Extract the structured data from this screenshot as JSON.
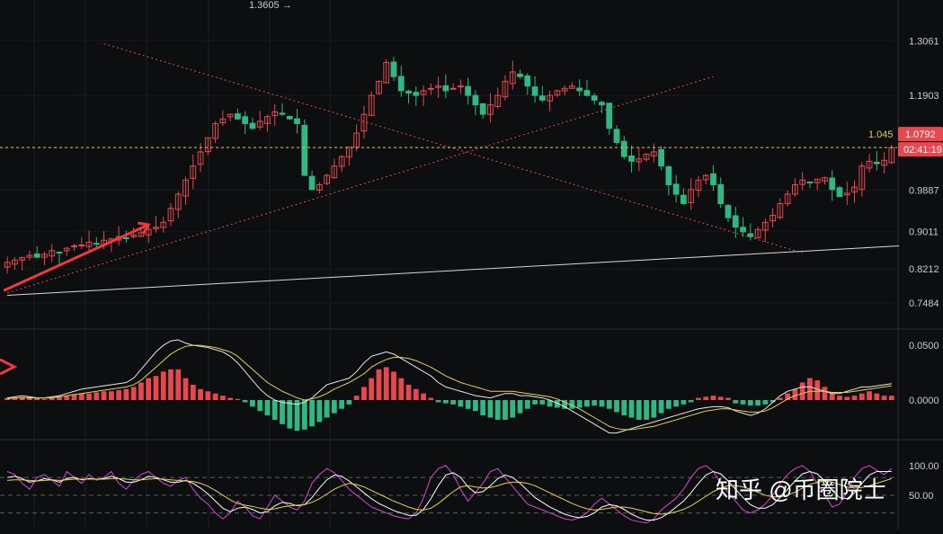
{
  "chart_data": [
    {
      "type": "candlestick",
      "panel": "price",
      "ylim": [
        0.72,
        1.37
      ],
      "y_ticks": [
        "1.3061",
        "1.1903",
        "1.0792",
        "0.9887",
        "0.9011",
        "0.8212",
        "0.7484"
      ],
      "y_tick_values": [
        1.3061,
        1.1903,
        1.0792,
        0.9887,
        0.9011,
        0.8212,
        0.7484
      ],
      "high_annotation": "1.3605 →",
      "high_value": 1.3605,
      "current_price": "1.0792",
      "current_price_value": 1.0792,
      "countdown": "02:41:19",
      "overlay_text": "1.045",
      "n_candles": 120,
      "approx_closes": [
        0.835,
        0.84,
        0.845,
        0.85,
        0.846,
        0.852,
        0.86,
        0.855,
        0.865,
        0.87,
        0.872,
        0.878,
        0.875,
        0.882,
        0.885,
        0.89,
        0.887,
        0.893,
        0.898,
        0.905,
        0.91,
        0.92,
        0.95,
        0.98,
        1.01,
        1.04,
        1.07,
        1.1,
        1.13,
        1.14,
        1.15,
        1.14,
        1.13,
        1.12,
        1.135,
        1.145,
        1.155,
        1.15,
        1.14,
        1.13,
        1.02,
        0.99,
        1.0,
        1.02,
        1.04,
        1.06,
        1.08,
        1.11,
        1.15,
        1.19,
        1.22,
        1.26,
        1.23,
        1.2,
        1.195,
        1.19,
        1.2,
        1.205,
        1.21,
        1.2,
        1.205,
        1.21,
        1.19,
        1.17,
        1.15,
        1.17,
        1.19,
        1.22,
        1.24,
        1.23,
        1.21,
        1.19,
        1.18,
        1.19,
        1.2,
        1.205,
        1.21,
        1.2,
        1.19,
        1.18,
        1.17,
        1.12,
        1.09,
        1.06,
        1.05,
        1.055,
        1.065,
        1.07,
        1.04,
        1.0,
        0.98,
        0.96,
        0.99,
        1.01,
        1.02,
        1.0,
        0.96,
        0.93,
        0.91,
        0.9,
        0.89,
        0.905,
        0.92,
        0.935,
        0.96,
        0.98,
        1.0,
        1.01,
        1.005,
        1.012,
        1.015,
        0.99,
        0.975,
        0.982,
        0.995,
        1.04,
        1.05,
        1.045,
        1.052,
        1.079
      ],
      "trendlines": [
        {
          "name": "descending-dotted",
          "points": [
            [
              13,
              1.3
            ],
            [
              107,
              0.855
            ]
          ]
        },
        {
          "name": "ascending-dotted",
          "points": [
            [
              0,
              0.77
            ],
            [
              95,
              1.23
            ]
          ]
        },
        {
          "name": "ascending-white",
          "points": [
            [
              0,
              0.765
            ],
            [
              120,
              0.87
            ]
          ]
        },
        {
          "name": "current-price-dashed",
          "points": [
            [
              0,
              1.0792
            ],
            [
              120,
              1.0792
            ]
          ]
        }
      ]
    },
    {
      "type": "histogram-line",
      "panel": "macd",
      "ylim": [
        -0.032,
        0.055
      ],
      "y_ticks": [
        "0.0500",
        "0.0000"
      ],
      "y_tick_values": [
        0.05,
        0.0
      ],
      "histogram": [
        0.002,
        0.002,
        0.003,
        0.003,
        0.002,
        0.001,
        0.002,
        0.003,
        0.004,
        0.005,
        0.006,
        0.006,
        0.007,
        0.008,
        0.008,
        0.009,
        0.01,
        0.012,
        0.016,
        0.02,
        0.022,
        0.026,
        0.028,
        0.028,
        0.02,
        0.014,
        0.01,
        0.008,
        0.006,
        0.004,
        0.002,
        0.001,
        -0.002,
        -0.006,
        -0.01,
        -0.014,
        -0.018,
        -0.022,
        -0.026,
        -0.028,
        -0.027,
        -0.024,
        -0.02,
        -0.016,
        -0.012,
        -0.008,
        -0.004,
        0.004,
        0.012,
        0.02,
        0.028,
        0.03,
        0.026,
        0.02,
        0.014,
        0.01,
        0.006,
        0.002,
        -0.002,
        -0.003,
        -0.004,
        -0.006,
        -0.008,
        -0.01,
        -0.014,
        -0.016,
        -0.018,
        -0.018,
        -0.016,
        -0.012,
        -0.008,
        -0.004,
        -0.004,
        -0.006,
        -0.007,
        -0.008,
        -0.008,
        -0.007,
        -0.006,
        -0.005,
        -0.006,
        -0.008,
        -0.011,
        -0.014,
        -0.016,
        -0.018,
        -0.018,
        -0.016,
        -0.012,
        -0.008,
        -0.006,
        -0.004,
        -0.002,
        0.002,
        0.003,
        0.004,
        0.003,
        0.002,
        -0.003,
        -0.004,
        -0.005,
        -0.005,
        -0.004,
        -0.002,
        0.002,
        0.006,
        0.01,
        0.016,
        0.02,
        0.018,
        0.012,
        0.006,
        0.004,
        0.003,
        0.004,
        0.006,
        0.008,
        0.006,
        0.004,
        0.004
      ],
      "line_macd": [
        0.002,
        0.003,
        0.004,
        0.003,
        0.002,
        0.002,
        0.003,
        0.004,
        0.006,
        0.008,
        0.01,
        0.011,
        0.012,
        0.013,
        0.014,
        0.015,
        0.016,
        0.02,
        0.028,
        0.036,
        0.044,
        0.05,
        0.054,
        0.055,
        0.052,
        0.05,
        0.049,
        0.048,
        0.046,
        0.044,
        0.04,
        0.034,
        0.026,
        0.018,
        0.01,
        0.004,
        0.0,
        -0.002,
        -0.003,
        -0.004,
        -0.002,
        0.002,
        0.008,
        0.014,
        0.016,
        0.018,
        0.02,
        0.026,
        0.034,
        0.04,
        0.042,
        0.044,
        0.042,
        0.038,
        0.034,
        0.03,
        0.026,
        0.022,
        0.016,
        0.012,
        0.01,
        0.008,
        0.006,
        0.004,
        0.003,
        0.002,
        0.004,
        0.006,
        0.006,
        0.004,
        0.004,
        0.003,
        0.002,
        0.0,
        -0.003,
        -0.006,
        -0.01,
        -0.014,
        -0.018,
        -0.022,
        -0.026,
        -0.03,
        -0.03,
        -0.028,
        -0.026,
        -0.024,
        -0.022,
        -0.02,
        -0.018,
        -0.016,
        -0.014,
        -0.012,
        -0.01,
        -0.008,
        -0.007,
        -0.006,
        -0.006,
        -0.007,
        -0.01,
        -0.012,
        -0.014,
        -0.012,
        -0.008,
        -0.002,
        0.004,
        0.008,
        0.01,
        0.012,
        0.012,
        0.01,
        0.008,
        0.006,
        0.006,
        0.008,
        0.01,
        0.012,
        0.012,
        0.013,
        0.014,
        0.015
      ],
      "line_signal": [
        0.001,
        0.002,
        0.002,
        0.002,
        0.002,
        0.002,
        0.002,
        0.003,
        0.004,
        0.005,
        0.006,
        0.007,
        0.008,
        0.009,
        0.01,
        0.011,
        0.012,
        0.014,
        0.018,
        0.024,
        0.03,
        0.036,
        0.042,
        0.046,
        0.049,
        0.05,
        0.05,
        0.049,
        0.048,
        0.046,
        0.044,
        0.04,
        0.034,
        0.028,
        0.022,
        0.016,
        0.012,
        0.008,
        0.005,
        0.002,
        0.0,
        0.001,
        0.003,
        0.006,
        0.01,
        0.013,
        0.016,
        0.02,
        0.024,
        0.03,
        0.034,
        0.037,
        0.039,
        0.039,
        0.038,
        0.036,
        0.033,
        0.03,
        0.026,
        0.022,
        0.019,
        0.016,
        0.014,
        0.012,
        0.01,
        0.008,
        0.008,
        0.008,
        0.008,
        0.007,
        0.006,
        0.005,
        0.004,
        0.003,
        0.001,
        -0.002,
        -0.005,
        -0.008,
        -0.012,
        -0.016,
        -0.02,
        -0.024,
        -0.026,
        -0.027,
        -0.027,
        -0.026,
        -0.025,
        -0.024,
        -0.022,
        -0.02,
        -0.018,
        -0.016,
        -0.014,
        -0.012,
        -0.01,
        -0.009,
        -0.008,
        -0.008,
        -0.009,
        -0.01,
        -0.011,
        -0.011,
        -0.01,
        -0.007,
        -0.003,
        0.001,
        0.004,
        0.006,
        0.008,
        0.008,
        0.008,
        0.007,
        0.007,
        0.007,
        0.008,
        0.009,
        0.01,
        0.011,
        0.012,
        0.013
      ]
    },
    {
      "type": "line",
      "panel": "stochastic",
      "ylim": [
        -8,
        112
      ],
      "y_ticks": [
        "100.00",
        "50.00"
      ],
      "y_tick_values": [
        100,
        50
      ],
      "dashed_levels": [
        80,
        50,
        20
      ],
      "series": [
        {
          "values": [
            90,
            85,
            70,
            60,
            80,
            85,
            75,
            65,
            90,
            80,
            70,
            85,
            75,
            80,
            90,
            70,
            60,
            75,
            85,
            90,
            80,
            70,
            65,
            75,
            80,
            60,
            45,
            35,
            20,
            10,
            20,
            40,
            30,
            15,
            10,
            30,
            50,
            40,
            30,
            25,
            40,
            70,
            85,
            95,
            88,
            75,
            60,
            50,
            40,
            30,
            25,
            20,
            15,
            12,
            10,
            20,
            45,
            80,
            95,
            100,
            85,
            60,
            40,
            55,
            70,
            90,
            95,
            80,
            65,
            50,
            35,
            30,
            25,
            20,
            15,
            10,
            8,
            12,
            20,
            35,
            45,
            35,
            25,
            15,
            8,
            5,
            3,
            10,
            25,
            35,
            45,
            60,
            80,
            95,
            100,
            90,
            70,
            55,
            40,
            25,
            20,
            25,
            35,
            50,
            70,
            85,
            95,
            100,
            90,
            70,
            50,
            30,
            35,
            55,
            80,
            95,
            100,
            92,
            85,
            95
          ]
        },
        {
          "values": [
            80,
            82,
            78,
            72,
            74,
            78,
            76,
            72,
            78,
            80,
            76,
            78,
            77,
            78,
            82,
            78,
            72,
            72,
            76,
            82,
            80,
            76,
            72,
            72,
            75,
            70,
            62,
            52,
            40,
            28,
            22,
            28,
            30,
            26,
            20,
            22,
            32,
            38,
            36,
            32,
            34,
            46,
            62,
            76,
            84,
            82,
            74,
            64,
            54,
            44,
            36,
            30,
            24,
            20,
            16,
            16,
            26,
            44,
            66,
            84,
            88,
            80,
            64,
            54,
            56,
            66,
            78,
            84,
            80,
            70,
            58,
            46,
            38,
            30,
            24,
            18,
            14,
            12,
            14,
            20,
            30,
            34,
            32,
            26,
            18,
            12,
            8,
            8,
            12,
            20,
            30,
            40,
            54,
            70,
            84,
            90,
            86,
            74,
            60,
            46,
            34,
            28,
            28,
            34,
            46,
            60,
            74,
            86,
            90,
            86,
            74,
            58,
            46,
            44,
            54,
            70,
            84,
            90,
            90,
            90
          ]
        },
        {
          "values": [
            75,
            76,
            76,
            75,
            74,
            75,
            76,
            75,
            76,
            77,
            77,
            77,
            77,
            77,
            78,
            78,
            77,
            76,
            76,
            77,
            78,
            77,
            76,
            75,
            74,
            73,
            70,
            65,
            58,
            50,
            42,
            36,
            33,
            31,
            28,
            26,
            27,
            30,
            32,
            33,
            34,
            38,
            44,
            52,
            60,
            66,
            70,
            68,
            64,
            58,
            52,
            46,
            40,
            35,
            30,
            26,
            25,
            28,
            36,
            46,
            56,
            64,
            66,
            64,
            62,
            63,
            66,
            70,
            72,
            72,
            70,
            66,
            60,
            54,
            48,
            42,
            36,
            31,
            27,
            25,
            26,
            28,
            30,
            30,
            28,
            25,
            22,
            19,
            18,
            19,
            22,
            26,
            32,
            40,
            48,
            56,
            62,
            66,
            66,
            64,
            60,
            55,
            50,
            47,
            47,
            50,
            55,
            62,
            68,
            72,
            74,
            72,
            68,
            64,
            62,
            63,
            66,
            70,
            74,
            78
          ]
        }
      ]
    }
  ],
  "watermark": {
    "text": "知乎 @币圈院士"
  },
  "colors": {
    "background": "#0d0e10",
    "up": "#e8484d",
    "down": "#2fb884",
    "trendline_dotted": "#e04a4a",
    "arrow": "#f03a3a",
    "white_line": "#d8d8d8",
    "current_price_line": "#e6c93a",
    "price_badge": "#e8484d",
    "macd_line": "#e8e8e8",
    "signal_line": "#e6d24a",
    "stoch_magenta": "#d946d9",
    "stoch_white": "#ffffff",
    "stoch_yellow": "#e6d24a"
  }
}
